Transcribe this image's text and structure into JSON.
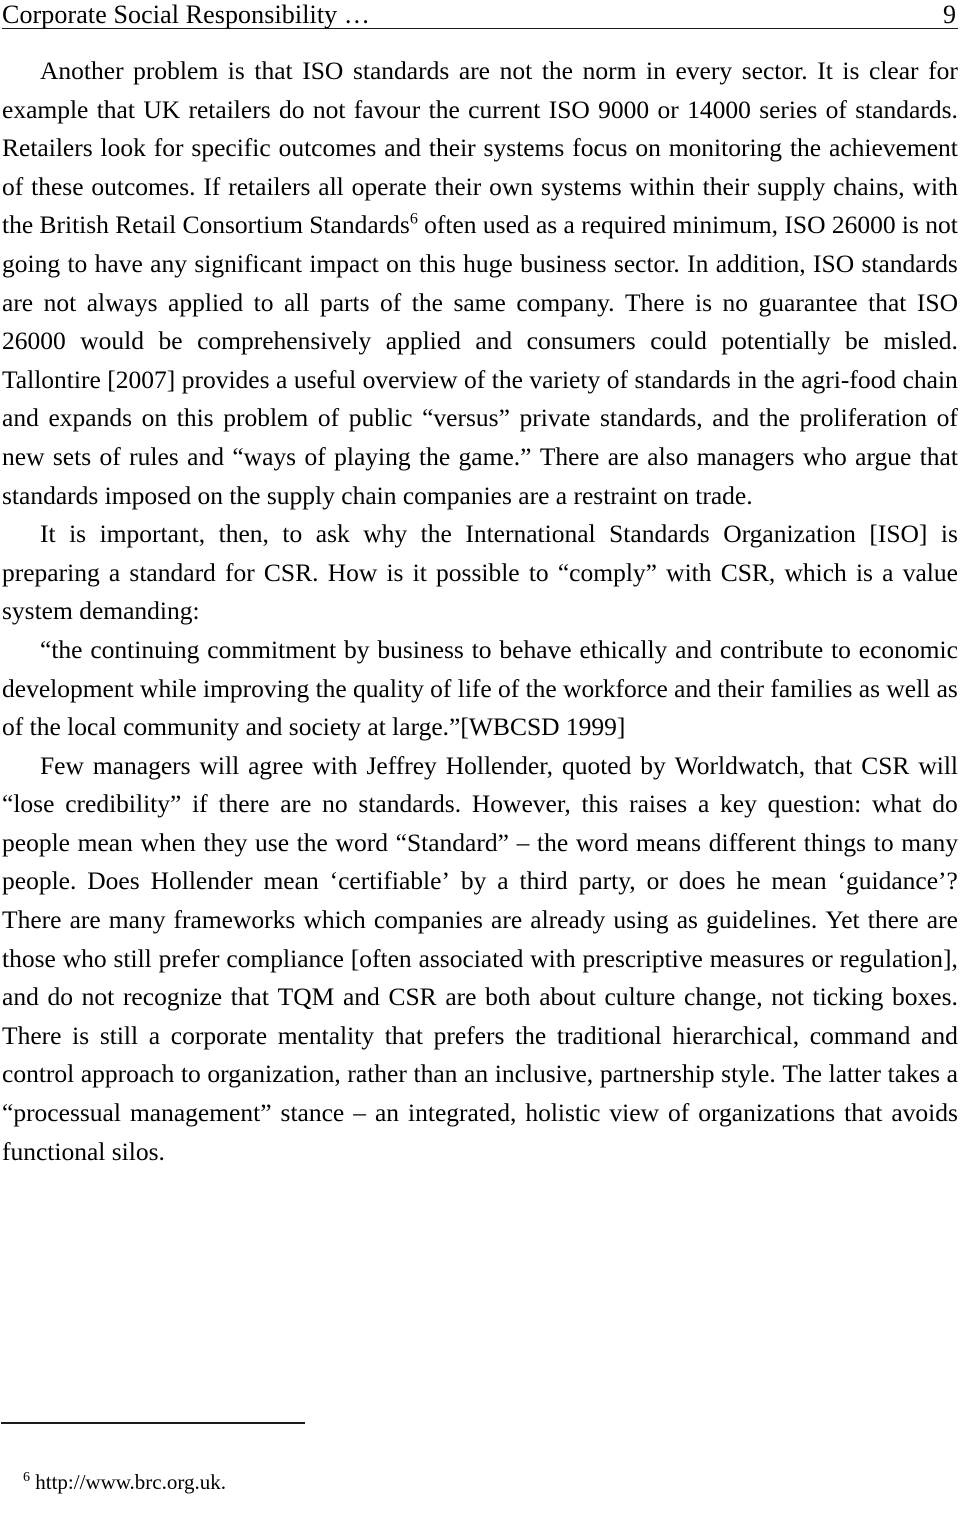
{
  "document": {
    "header": {
      "title": "Corporate Social Responsibility …",
      "page_number": "9"
    },
    "body_lines": [
      {
        "id": "l01",
        "style": "just-indent",
        "text": "Another problem is that ISO standards are not the norm in every sector. It is clear for"
      },
      {
        "id": "l02",
        "style": "just",
        "text": "example that UK retailers do not favour the current ISO 9000 or 14000 series of standards."
      },
      {
        "id": "l03",
        "style": "just",
        "text": "Retailers look for specific outcomes and their systems focus on monitoring the achievement"
      },
      {
        "id": "l04",
        "style": "just",
        "text": "of these outcomes.  If retailers all operate their own systems within their supply chains, with"
      },
      {
        "id": "l05",
        "style": "just-sup6",
        "text": "the British Retail Consortium Standards",
        "text_after": " often used as a required minimum, ISO 26000 is not",
        "superscript": "6"
      },
      {
        "id": "l06",
        "style": "just",
        "text": "going to have any significant impact on this huge business sector. In addition, ISO standards"
      },
      {
        "id": "l07",
        "style": "just",
        "text": "are not always applied to all parts of the same company. There is no guarantee that ISO"
      },
      {
        "id": "l08",
        "style": "just",
        "text": "26000 would be comprehensively applied and consumers could potentially be misled."
      },
      {
        "id": "l09",
        "style": "just",
        "text": "Tallontire [2007] provides a useful overview of the variety of standards in the agri-food chain"
      },
      {
        "id": "l10",
        "style": "just",
        "text": "and expands on this problem of public “versus” private standards, and the proliferation of"
      },
      {
        "id": "l11",
        "style": "just",
        "text": "new sets of rules and “ways of playing the game.”  There are also managers who argue that"
      },
      {
        "id": "l12",
        "style": "flush",
        "text": "standards imposed on the supply chain companies are a restraint on trade."
      },
      {
        "id": "l13",
        "style": "just-indent",
        "text": "It is important, then, to ask why the International Standards Organization [ISO] is"
      },
      {
        "id": "l14",
        "style": "just",
        "text": "preparing a standard for CSR. How is it possible to “comply” with CSR, which is a value"
      },
      {
        "id": "l15",
        "style": "flush",
        "text": "system demanding:"
      },
      {
        "id": "l16",
        "style": "just-indent",
        "text": "“the continuing commitment by business to behave ethically and contribute to economic"
      },
      {
        "id": "l17",
        "style": "just",
        "text": "development while improving the quality of life of the workforce and their families as well as"
      },
      {
        "id": "l18",
        "style": "flush",
        "text": "of the local community and society at large.”[WBCSD 1999]"
      },
      {
        "id": "l19",
        "style": "just-indent",
        "text": "Few managers will agree with Jeffrey Hollender, quoted by Worldwatch, that CSR will"
      },
      {
        "id": "l20",
        "style": "just",
        "text": "“lose credibility” if there are no standards. However, this raises a key question:  what do"
      },
      {
        "id": "l21",
        "style": "just",
        "text": "people mean when they use the word “Standard” – the word means different things to many"
      },
      {
        "id": "l22",
        "style": "just",
        "text": "people. Does Hollender mean ‘certifiable’ by a third party, or does he mean ‘guidance’?"
      },
      {
        "id": "l23",
        "style": "just",
        "text": "There are many frameworks which companies are already using as guidelines. Yet there are"
      },
      {
        "id": "l24",
        "style": "just",
        "text": "those who still prefer compliance [often associated with prescriptive measures or regulation],"
      },
      {
        "id": "l25",
        "style": "just",
        "text": "and do not recognize that TQM and CSR are both about culture change, not ticking boxes."
      },
      {
        "id": "l26",
        "style": "just",
        "text": "There is still a corporate mentality that prefers the traditional hierarchical, command and"
      },
      {
        "id": "l27",
        "style": "just",
        "text": "control approach to organization, rather than an inclusive, partnership style. The latter takes a"
      },
      {
        "id": "l28",
        "style": "just",
        "text": "“processual management” stance – an integrated, holistic view of organizations that avoids"
      },
      {
        "id": "l29",
        "style": "flush",
        "text": "functional silos."
      }
    ],
    "footnote": {
      "marker": "6",
      "text": " http://www.brc.org.uk."
    },
    "colors": {
      "text": "#000000",
      "rule": "#1a1a1a",
      "background": "#ffffff"
    }
  }
}
